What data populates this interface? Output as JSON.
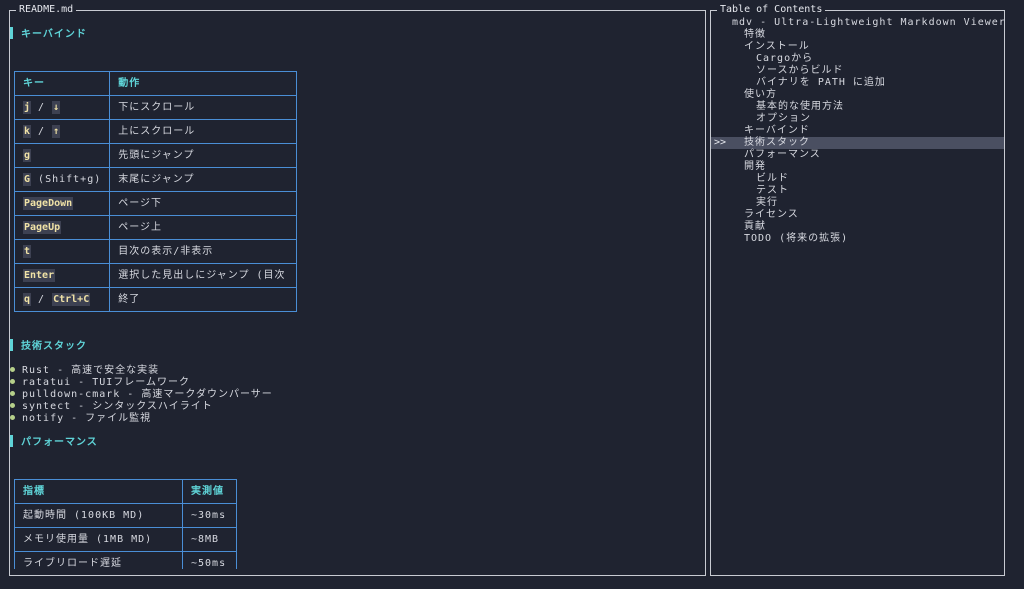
{
  "viewer": {
    "title": "README.md",
    "sections": {
      "keybind_heading": "キーバインド",
      "keybind_table": {
        "headers": [
          "キー",
          "動作"
        ],
        "rows": [
          {
            "k1": "j",
            "sep": " / ",
            "k2": "↓",
            "extra": "",
            "action": "下にスクロール"
          },
          {
            "k1": "k",
            "sep": " / ",
            "k2": "↑",
            "extra": "",
            "action": "上にスクロール"
          },
          {
            "k1": "g",
            "sep": "",
            "k2": "",
            "extra": "",
            "action": "先頭にジャンプ"
          },
          {
            "k1": "G",
            "sep": "",
            "k2": "",
            "extra": " (Shift+g)",
            "action": "末尾にジャンプ"
          },
          {
            "k1": "PageDown",
            "sep": "",
            "k2": "",
            "extra": "",
            "action": "ページ下"
          },
          {
            "k1": "PageUp",
            "sep": "",
            "k2": "",
            "extra": "",
            "action": "ページ上"
          },
          {
            "k1": "t",
            "sep": "",
            "k2": "",
            "extra": "",
            "action": "目次の表示/非表示"
          },
          {
            "k1": "Enter",
            "sep": "",
            "k2": "",
            "extra": "",
            "action": "選択した見出しにジャンプ (目次"
          },
          {
            "k1": "q",
            "sep": " / ",
            "k2": "Ctrl+C",
            "extra": "",
            "action": "終了"
          }
        ]
      },
      "tech_heading": "技術スタック",
      "tech_items": [
        "Rust - 高速で安全な実装",
        "ratatui - TUIフレームワーク",
        "pulldown-cmark - 高速マークダウンパーサー",
        "syntect - シンタックスハイライト",
        "notify - ファイル監視"
      ],
      "perf_heading": "パフォーマンス",
      "perf_table": {
        "headers": [
          "指標",
          "実測値"
        ],
        "rows": [
          {
            "metric": "起動時間 (100KB MD)",
            "value": "~30ms"
          },
          {
            "metric": "メモリ使用量 (1MB MD)",
            "value": "~8MB"
          },
          {
            "metric": "ライブリロード遅延",
            "value": "~50ms"
          }
        ]
      }
    }
  },
  "toc": {
    "title": "Table of Contents",
    "selected_marker": ">>",
    "items": [
      {
        "label": "mdv - Ultra-Lightweight Markdown Viewer",
        "level": 1
      },
      {
        "label": "特徴",
        "level": 2
      },
      {
        "label": "インストール",
        "level": 2
      },
      {
        "label": "Cargoから",
        "level": 3
      },
      {
        "label": "ソースからビルド",
        "level": 3
      },
      {
        "label": "バイナリを PATH に追加",
        "level": 3
      },
      {
        "label": "使い方",
        "level": 2
      },
      {
        "label": "基本的な使用方法",
        "level": 3
      },
      {
        "label": "オプション",
        "level": 3
      },
      {
        "label": "キーバインド",
        "level": 2
      },
      {
        "label": "技術スタック",
        "level": 2,
        "selected": true
      },
      {
        "label": "パフォーマンス",
        "level": 2
      },
      {
        "label": "開発",
        "level": 2
      },
      {
        "label": "ビルド",
        "level": 3
      },
      {
        "label": "テスト",
        "level": 3
      },
      {
        "label": "実行",
        "level": 3
      },
      {
        "label": "ライセンス",
        "level": 2
      },
      {
        "label": "貢献",
        "level": 2
      },
      {
        "label": "TODO (将来の拡張)",
        "level": 2
      }
    ]
  },
  "colors": {
    "background": "#1f2330",
    "heading": "#5fd4d8",
    "table_border": "#4a8ed6",
    "code_bg": "#3d4152",
    "code_fg": "#f0e2a6",
    "selection": "#4a4f61",
    "bullet": "#b6d08a"
  }
}
